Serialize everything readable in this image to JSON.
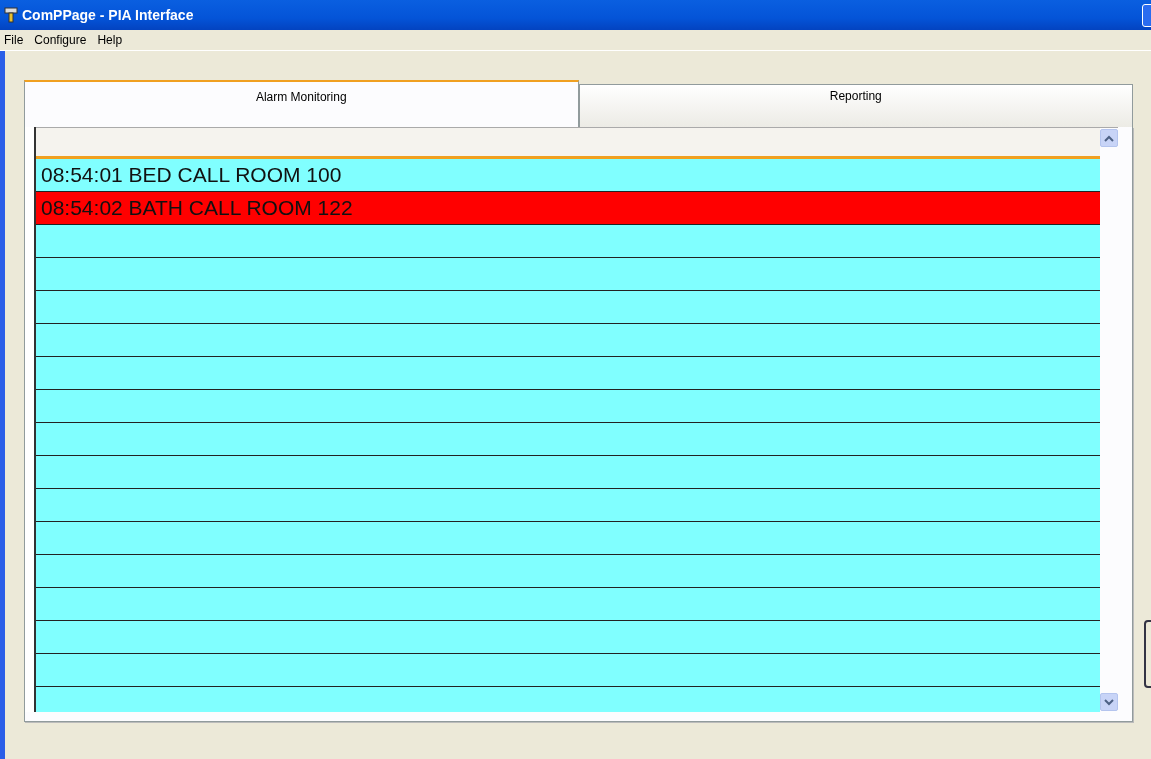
{
  "window": {
    "title": "ComPPage - PIA Interface"
  },
  "menu": [
    "File",
    "Configure",
    "Help"
  ],
  "tabs": [
    {
      "label": "Alarm Monitoring",
      "selected": true
    },
    {
      "label": "Reporting",
      "selected": false
    }
  ],
  "alarms": [
    {
      "text": "08:54:01 BED CALL ROOM 100",
      "color": "#80ffff"
    },
    {
      "text": "08:54:02 BATH CALL ROOM 122",
      "color": "#ff0000"
    }
  ]
}
